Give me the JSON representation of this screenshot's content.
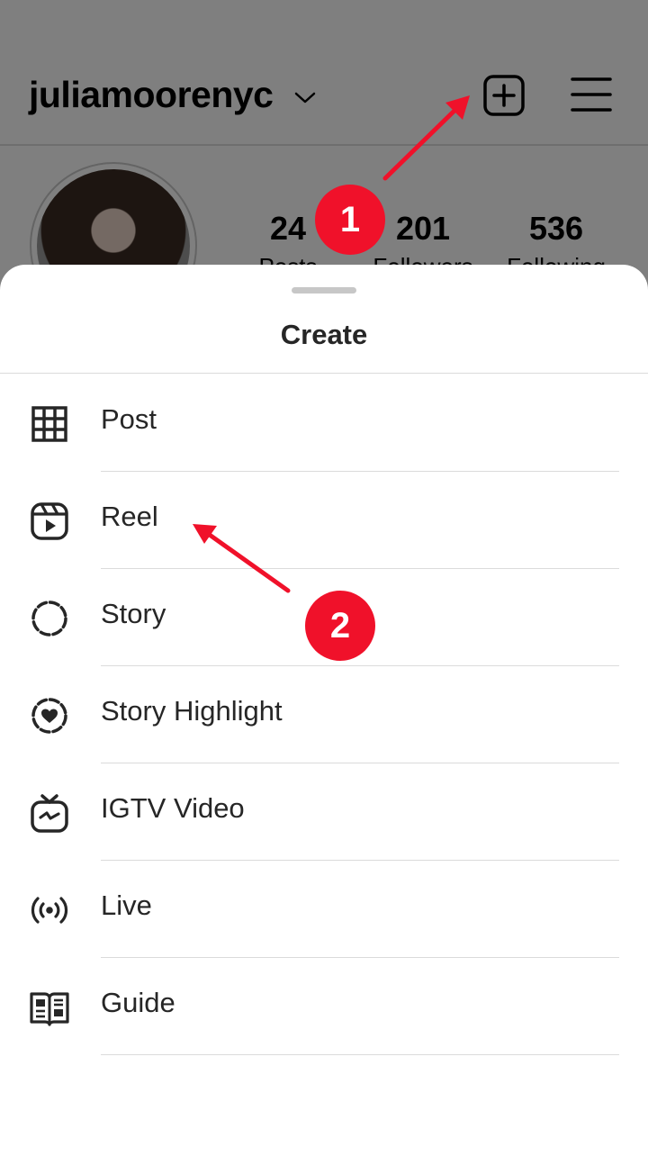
{
  "profile": {
    "username": "juliamoorenyc",
    "stats": [
      {
        "value": "24",
        "label": "Posts"
      },
      {
        "value": "201",
        "label": "Followers"
      },
      {
        "value": "536",
        "label": "Following"
      }
    ]
  },
  "sheet": {
    "title": "Create",
    "items": [
      {
        "label": "Post",
        "icon": "grid-icon"
      },
      {
        "label": "Reel",
        "icon": "reels-icon"
      },
      {
        "label": "Story",
        "icon": "story-icon"
      },
      {
        "label": "Story Highlight",
        "icon": "story-highlight-icon"
      },
      {
        "label": "IGTV Video",
        "icon": "igtv-icon"
      },
      {
        "label": "Live",
        "icon": "live-icon"
      },
      {
        "label": "Guide",
        "icon": "guide-icon"
      }
    ]
  },
  "annotations": {
    "step1": "1",
    "step2": "2",
    "color": "#f0112a"
  }
}
